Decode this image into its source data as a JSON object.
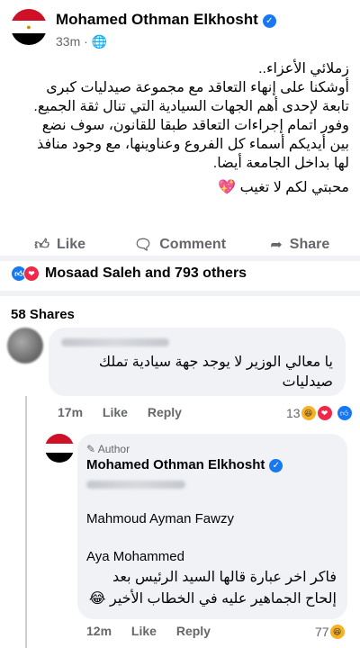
{
  "post": {
    "author": "Mohamed Othman Elkhosht",
    "time": "33m",
    "privacy_dot": "·",
    "lines": [
      "زملائي الأعزاء..",
      "أوشكنا على إنهاء التعاقد مع مجموعة صيدليات كبرى",
      "تابعة لإحدى أهم الجهات السيادية التي تنال ثقة الجميع.",
      "وفور اتمام إجراءات التعاقد طبقا للقانون، سوف نضع",
      "بين أيديكم أسماء كل الفروع وعناوينها، مع وجود منافذ",
      "لها بداخل الجامعة أيضا."
    ],
    "sign_off": "محبتي لكم لا تغيب",
    "actions": {
      "like": "Like",
      "comment": "Comment",
      "share": "Share"
    },
    "reactions_text": "Mosaad Saleh and 793 others",
    "shares": "58 Shares"
  },
  "comment1": {
    "lines": [
      "يا معالي الوزير لا يوجد جهة سيادية تملك",
      "صيدليات"
    ],
    "time": "17m",
    "like": "Like",
    "reply": "Reply",
    "count": "13"
  },
  "reply": {
    "author_tag": "Author",
    "name": "Mohamed Othman Elkhosht",
    "mention1": "Mahmoud Ayman Fawzy",
    "mention2": "Aya Mohammed",
    "lines": [
      "فاكر اخر عبارة قالها السيد الرئيس بعد",
      "إلحاح الجماهير عليه في الخطاب الأخير"
    ],
    "time": "12m",
    "like": "Like",
    "reply": "Reply",
    "count": "77"
  },
  "colors": {
    "accent": "#1877f2",
    "love": "#f02849",
    "muted": "#65676b"
  }
}
